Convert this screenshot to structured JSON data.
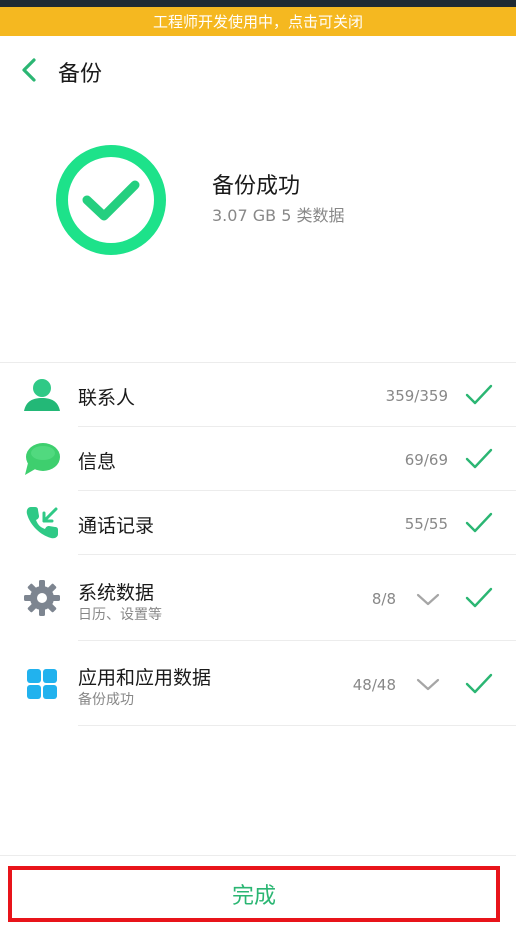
{
  "colors": {
    "accent_green": "#2bb673",
    "banner_yellow": "#f5b820",
    "highlight_red": "#e8141a"
  },
  "banner": {
    "text": "工程师开发使用中，点击可关闭"
  },
  "header": {
    "title": "备份",
    "back_icon": "chevron-left-icon"
  },
  "result": {
    "title": "备份成功",
    "size": "3.07 GB",
    "categories": "5 类数据",
    "icon": "check-circle-icon"
  },
  "items": [
    {
      "label": "联系人",
      "count": "359/359",
      "icon": "contact-person-icon",
      "checked": true
    },
    {
      "label": "信息",
      "count": "69/69",
      "icon": "message-bubble-icon",
      "checked": true
    },
    {
      "label": "通话记录",
      "count": "55/55",
      "icon": "call-log-icon",
      "checked": true
    },
    {
      "label": "系统数据",
      "sub": "日历、设置等",
      "count": "8/8",
      "icon": "gear-icon",
      "expandable": true,
      "checked": true
    },
    {
      "label": "应用和应用数据",
      "sub": "备份成功",
      "count": "48/48",
      "icon": "app-grid-icon",
      "expandable": true,
      "checked": true
    }
  ],
  "footer": {
    "done_label": "完成"
  }
}
